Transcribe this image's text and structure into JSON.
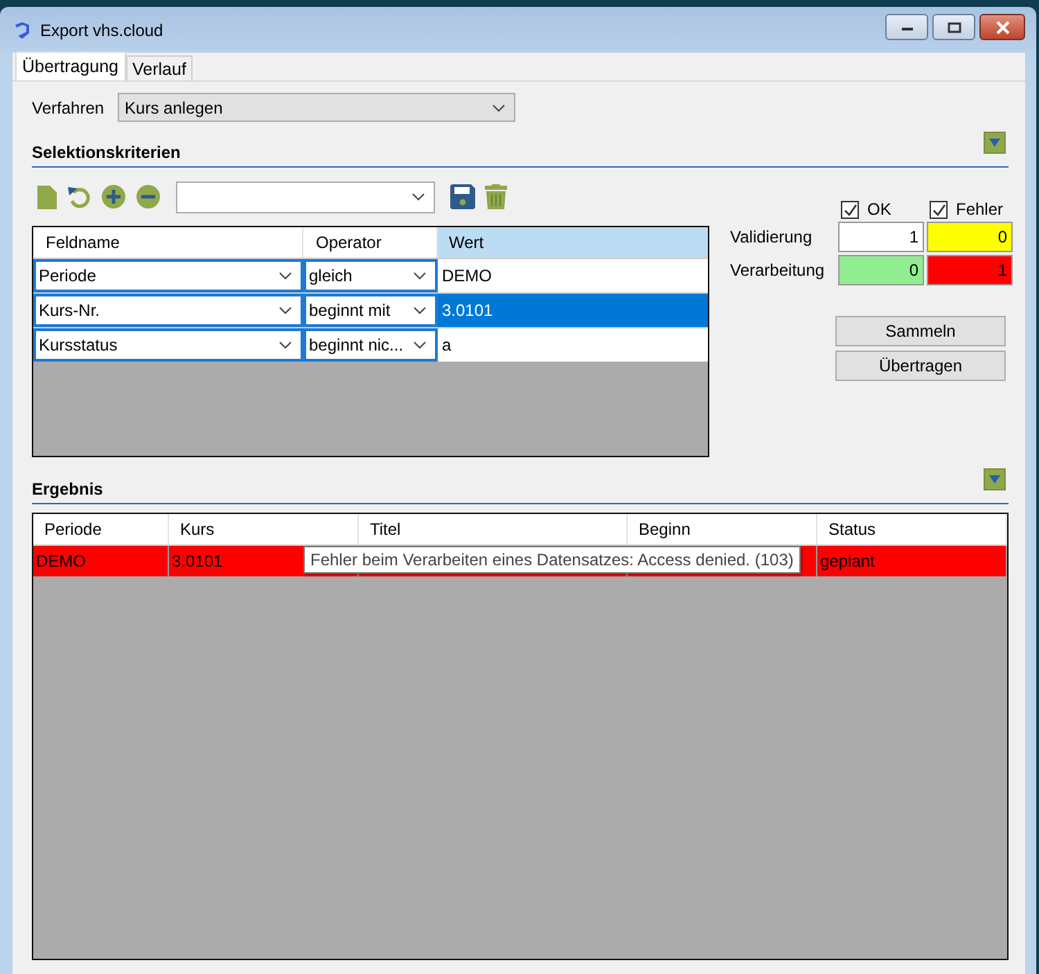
{
  "window": {
    "title": "Export vhs.cloud"
  },
  "tabs": [
    {
      "label": "Übertragung",
      "selected": true
    },
    {
      "label": "Verlauf",
      "selected": false
    }
  ],
  "procedure": {
    "label": "Verfahren",
    "value": "Kurs anlegen"
  },
  "criteria": {
    "title": "Selektionskriterien",
    "columns": [
      "Feldname",
      "Operator",
      "Wert"
    ],
    "rows": [
      {
        "field": "Periode",
        "operator": "gleich",
        "value": "DEMO",
        "selected": false
      },
      {
        "field": "Kurs-Nr.",
        "operator": "beginnt mit",
        "value": "3.0101",
        "selected": true
      },
      {
        "field": "Kursstatus",
        "operator": "beginnt nic...",
        "value": "a",
        "selected": false
      }
    ]
  },
  "counters": {
    "columns": [
      {
        "label": "OK",
        "checked": true
      },
      {
        "label": "Fehler",
        "checked": true
      }
    ],
    "rows": [
      {
        "label": "Validierung",
        "cells": [
          {
            "value": "1",
            "color": "#ffffff"
          },
          {
            "value": "0",
            "color": "#ffff00"
          }
        ]
      },
      {
        "label": "Verarbeitung",
        "cells": [
          {
            "value": "0",
            "color": "#90ee90"
          },
          {
            "value": "1",
            "color": "#ff0000"
          }
        ]
      }
    ]
  },
  "buttons": [
    "Sammeln",
    "Übertragen"
  ],
  "result": {
    "title": "Ergebnis",
    "columns": [
      "Periode",
      "Kurs",
      "Titel",
      "Beginn",
      "Status"
    ],
    "rows": [
      {
        "color": "#ff0000",
        "cells": [
          "DEMO",
          "3.0101",
          "",
          "",
          "geplant"
        ]
      }
    ],
    "tooltip": "Fehler beim Verarbeiten eines Datensatzes: Access denied. (103)"
  }
}
